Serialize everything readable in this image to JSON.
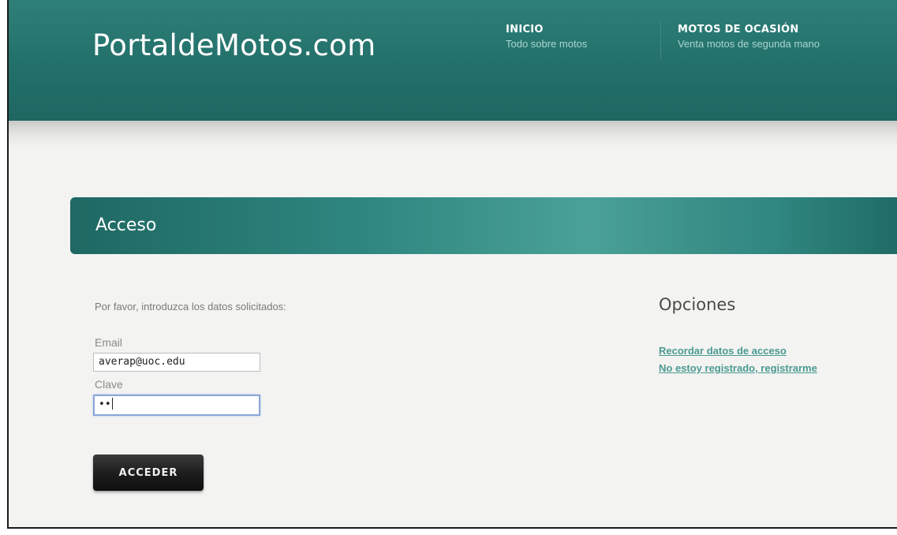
{
  "brand": {
    "logo_text": "PortaldeMotos.com"
  },
  "nav": [
    {
      "title": "INICIO",
      "subtitle": "Todo sobre motos"
    },
    {
      "title": "MOTOS DE OCASIÓN",
      "subtitle": "Venta motos de segunda mano"
    }
  ],
  "section": {
    "title": "Acceso"
  },
  "form": {
    "instructions": "Por favor, introduzca los datos solicitados:",
    "email_label": "Email",
    "email_value": "averap@uoc.edu",
    "password_label": "Clave",
    "password_mask": "••",
    "submit_label": "ACCEDER"
  },
  "options": {
    "title": "Opciones",
    "links": [
      "Recordar datos de acceso",
      "No estoy registrado, registrarme"
    ]
  },
  "colors": {
    "header": "#23706a",
    "accent_link": "#4a9a92",
    "button": "#1c1c1c"
  }
}
